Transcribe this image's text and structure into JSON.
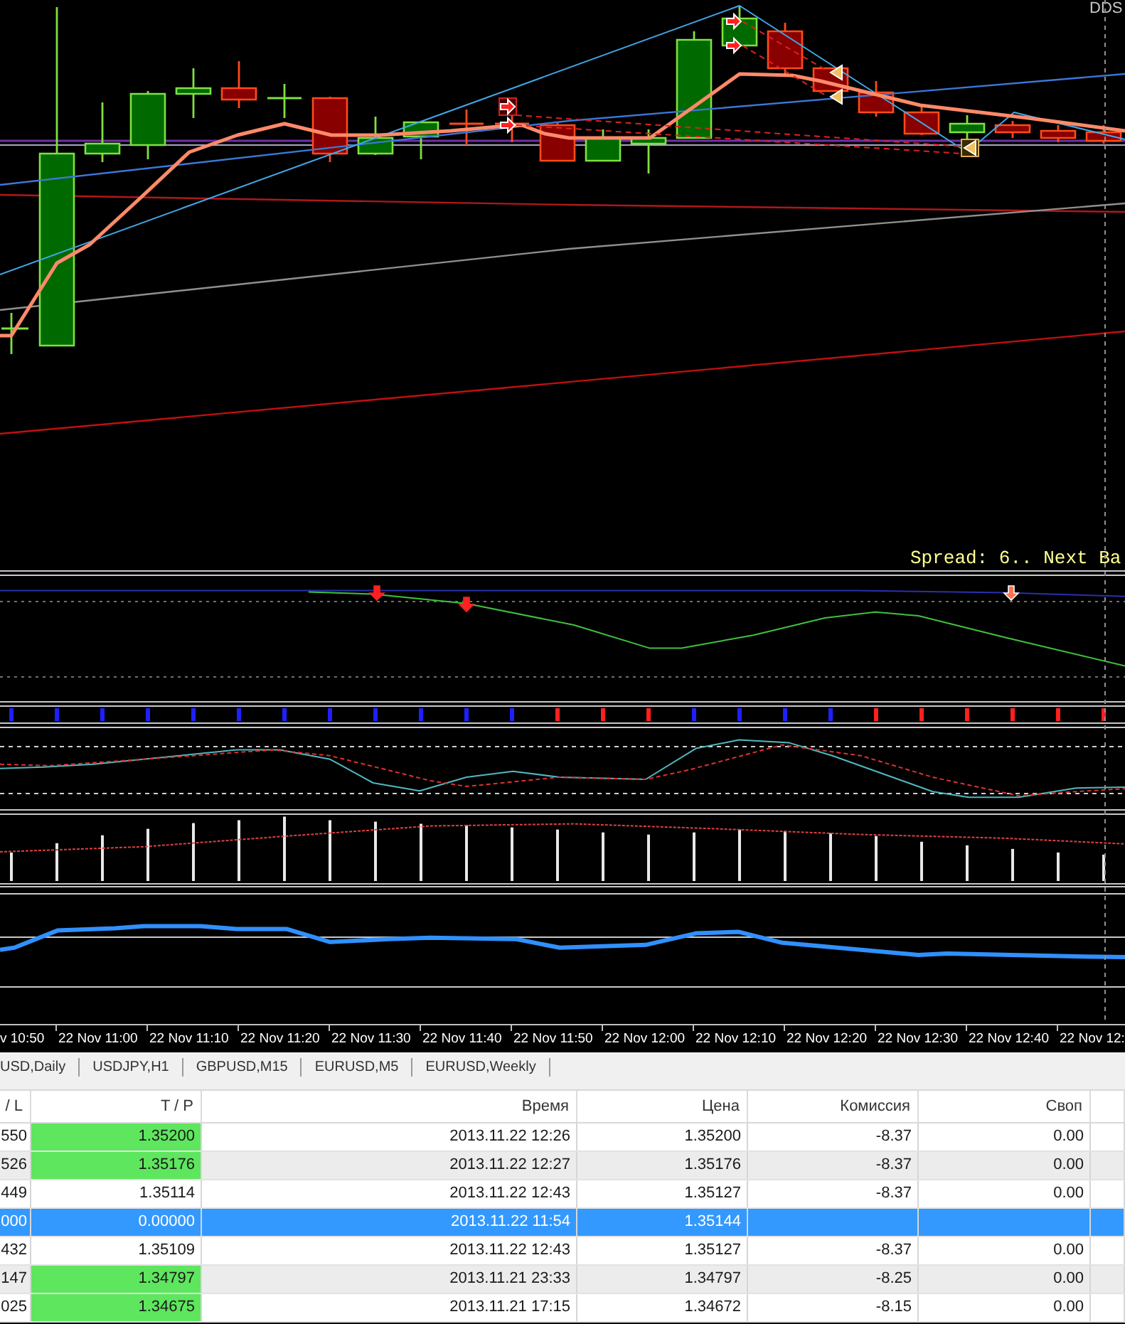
{
  "chart": {
    "corner_label": "DDS",
    "spread_label": "Spread: 6.. Next Ba"
  },
  "time_axis": {
    "labels": [
      "v 10:50",
      "22 Nov 11:00",
      "22 Nov 11:10",
      "22 Nov 11:20",
      "22 Nov 11:30",
      "22 Nov 11:40",
      "22 Nov 11:50",
      "22 Nov 12:00",
      "22 Nov 12:10",
      "22 Nov 12:20",
      "22 Nov 12:30",
      "22 Nov 12:40",
      "22 Nov 12:"
    ]
  },
  "symbol_tabs": [
    {
      "label": "USD,Daily",
      "selected": false
    },
    {
      "label": "USDJPY,H1",
      "selected": false
    },
    {
      "label": "GBPUSD,M15",
      "selected": false
    },
    {
      "label": "EURUSD,M5",
      "selected": false
    },
    {
      "label": "EURUSD,Weekly",
      "selected": false
    }
  ],
  "table": {
    "columns": [
      "/ L",
      "T / P",
      "Время",
      "Цена",
      "Комиссия",
      "Своп"
    ],
    "rows": [
      {
        "cells": [
          "550",
          "1.35200",
          "2013.11.22 12:26",
          "1.35200",
          "-8.37",
          "0.00"
        ],
        "tp_highlighted": true,
        "selected": false
      },
      {
        "cells": [
          "526",
          "1.35176",
          "2013.11.22 12:27",
          "1.35176",
          "-8.37",
          "0.00"
        ],
        "tp_highlighted": true,
        "selected": false
      },
      {
        "cells": [
          "449",
          "1.35114",
          "2013.11.22 12:43",
          "1.35127",
          "-8.37",
          "0.00"
        ],
        "tp_highlighted": false,
        "selected": false
      },
      {
        "cells": [
          "000",
          "0.00000",
          "2013.11.22 11:54",
          "1.35144"
        ],
        "tp_highlighted": false,
        "selected": true
      },
      {
        "cells": [
          "432",
          "1.35109",
          "2013.11.22 12:43",
          "1.35127",
          "-8.37",
          "0.00"
        ],
        "tp_highlighted": false,
        "selected": false
      },
      {
        "cells": [
          "147",
          "1.34797",
          "2013.11.21 23:33",
          "1.34797",
          "-8.25",
          "0.00"
        ],
        "tp_highlighted": true,
        "selected": false
      },
      {
        "cells": [
          "025",
          "1.34675",
          "2013.11.21 17:15",
          "1.34672",
          "-8.15",
          "0.00"
        ],
        "tp_highlighted": true,
        "selected": false
      }
    ]
  }
}
